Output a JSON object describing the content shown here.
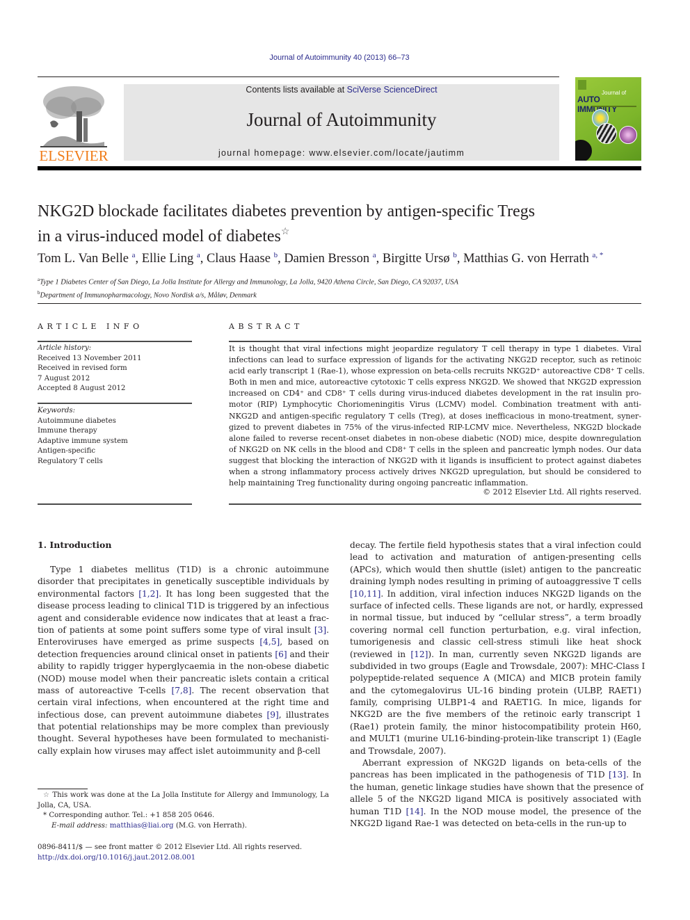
{
  "running_head": "Journal of Autoimmunity 40 (2013) 66–73",
  "masthead": {
    "publisher_wordmark": "ELSEVIER",
    "contents_prefix": "Contents lists available at ",
    "contents_link": "SciVerse ScienceDirect",
    "journal_title": "Journal of Autoimmunity",
    "homepage_prefix": "journal homepage: ",
    "homepage_url": "www.elsevier.com/locate/jautimm",
    "cover": {
      "line1": "Journal of",
      "line2": "AUTO IMMUNITY"
    },
    "colors": {
      "elsevier_orange": "#f07d1a",
      "link_blue": "#2a2a8c",
      "banner_gray": "#e6e6e6",
      "cover_green": "#8cc034"
    }
  },
  "article": {
    "title_line1": "NKG2D blockade facilitates diabetes prevention by antigen-specific Tregs",
    "title_line2": "in a virus-induced model of diabetes",
    "title_mark": "☆",
    "authors": [
      {
        "name": "Tom L. Van Belle",
        "aff": "a"
      },
      {
        "name": "Ellie Ling",
        "aff": "a"
      },
      {
        "name": "Claus Haase",
        "aff": "b"
      },
      {
        "name": "Damien Bresson",
        "aff": "a"
      },
      {
        "name": "Birgitte Ursø",
        "aff": "b"
      },
      {
        "name": "Matthias G. von Herrath",
        "aff": "a, *"
      }
    ],
    "affiliations": [
      {
        "mark": "a",
        "text": "Type 1 Diabetes Center of San Diego, La Jolla Institute for Allergy and Immunology, La Jolla, 9420 Athena Circle, San Diego, CA 92037, USA"
      },
      {
        "mark": "b",
        "text": "Department of Immunopharmacology, Novo Nordisk a/s, Måløv, Denmark"
      }
    ]
  },
  "article_info": {
    "heading": "ARTICLE INFO",
    "history_label": "Article history:",
    "history": [
      "Received 13 November 2011",
      "Received in revised form",
      "7 August 2012",
      "Accepted 8 August 2012"
    ],
    "keywords_label": "Keywords:",
    "keywords": [
      "Autoimmune diabetes",
      "Immune therapy",
      "Adaptive immune system",
      "Antigen-specific",
      "Regulatory T cells"
    ]
  },
  "abstract": {
    "heading": "ABSTRACT",
    "lines": [
      "It is thought that viral infections might jeopardize regulatory T cell therapy in type 1 diabetes. Viral",
      "infections can lead to surface expression of ligands for the activating NKG2D receptor, such as retinoic",
      "acid early transcript 1 (Rae-1), whose expression on beta-cells recruits NKG2D⁺ autoreactive CD8⁺ T cells.",
      "Both in men and mice, autoreactive cytotoxic T cells express NKG2D. We showed that NKG2D expression",
      "increased on CD4⁺ and CD8⁺ T cells during virus-induced diabetes development in the rat insulin pro-",
      "motor (RIP) Lymphocytic Choriomeningitis Virus (LCMV) model. Combination treatment with anti-",
      "NKG2D and antigen-specific regulatory T cells (Treg), at doses inefficacious in mono-treatment, syner-",
      "gized to prevent diabetes in 75% of the virus-infected RIP-LCMV mice. Nevertheless, NKG2D blockade",
      "alone failed to reverse recent-onset diabetes in non-obese diabetic (NOD) mice, despite downregulation",
      "of NKG2D on NK cells in the blood and CD8⁺ T cells in the spleen and pancreatic lymph nodes. Our data",
      "suggest that blocking the interaction of NKG2D with it ligands is insufficient to protect against diabetes",
      "when a strong inflammatory process actively drives NKG2D upregulation, but should be considered to",
      "help maintaining Treg functionality during ongoing pancreatic inflammation."
    ],
    "copyright": "© 2012 Elsevier Ltd. All rights reserved."
  },
  "body": {
    "section_heading": "1.  Introduction",
    "left_lines": [
      "Type 1 diabetes mellitus (T1D) is a chronic autoimmune",
      "disorder that precipitates in genetically susceptible individuals by",
      "environmental factors [1,2]. It has long been suggested that the",
      "disease process leading to clinical T1D is triggered by an infectious",
      "agent and considerable evidence now indicates that at least a frac-",
      "tion of patients at some point suffers some type of viral insult [3].",
      "Enteroviruses have emerged as prime suspects [4,5], based on",
      "detection frequencies around clinical onset in patients [6] and their",
      "ability to rapidly trigger hyperglycaemia in the non-obese diabetic",
      "(NOD) mouse model when their pancreatic islets contain a critical",
      "mass of autoreactive T-cells [7,8]. The recent observation that",
      "certain viral infections, when encountered at the right time and",
      "infectious dose, can prevent autoimmune diabetes [9], illustrates",
      "that potential relationships may be more complex than previously",
      "thought. Several hypotheses have been formulated to mechanisti-",
      "cally explain how viruses may affect islet autoimmunity and β-cell"
    ],
    "right_lines": [
      "decay. The fertile field hypothesis states that a viral infection could",
      "lead to activation and maturation of antigen-presenting cells",
      "(APCs), which would then shuttle (islet) antigen to the pancreatic",
      "draining lymph nodes resulting in priming of autoaggressive T cells",
      "[10,11]. In addition, viral infection induces NKG2D ligands on the",
      "surface of infected cells. These ligands are not, or hardly, expressed",
      "in normal tissue, but induced by “cellular stress”, a term broadly",
      "covering normal cell function perturbation, e.g. viral infection,",
      "tumorigenesis and classic cell-stress stimuli like heat shock",
      "(reviewed in [12]). In man, currently seven NKG2D ligands are",
      "subdivided in two groups (Eagle and Trowsdale, 2007): MHC-Class I",
      "polypeptide-related sequence A (MICA) and MICB protein family",
      "and the cytomegalovirus UL-16 binding protein (ULBP, RAET1)",
      "family, comprising ULBP1-4 and RAET1G. In mice, ligands for",
      "NKG2D are the five members of the retinoic early transcript 1",
      "(Rae1) protein family, the minor histocompatibility protein H60,",
      "and MULT1 (murine UL16-binding-protein-like transcript 1) (Eagle",
      "and Trowsdale, 2007).",
      "Aberrant expression of NKG2D ligands on beta-cells of the",
      "pancreas has been implicated in the pathogenesis of T1D [13]. In",
      "the human, genetic linkage studies have shown that the presence of",
      "allele 5 of the NKG2D ligand MICA is positively associated with",
      "human T1D [14]. In the NOD mouse model, the presence of the",
      "NKG2D ligand Rae-1 was detected on beta-cells in the run-up to"
    ],
    "citations": [
      "[1,2]",
      "[3]",
      "[4,5]",
      "[6]",
      "[7,8]",
      "[9]",
      "[10,11]",
      "[12]",
      "[13]",
      "[14]"
    ]
  },
  "footnotes": {
    "star_note": "This work was done at the La Jolla Institute for Allergy and Immunology, La Jolla, CA, USA.",
    "corresponding": "Corresponding author. Tel.: +1 858 205 0646.",
    "email_label": "E-mail address:",
    "email": "matthias@liai.org",
    "email_owner": "(M.G. von Herrath).",
    "issn_line": "0896-8411/$ — see front matter © 2012 Elsevier Ltd. All rights reserved.",
    "doi": "http://dx.doi.org/10.1016/j.jaut.2012.08.001"
  }
}
